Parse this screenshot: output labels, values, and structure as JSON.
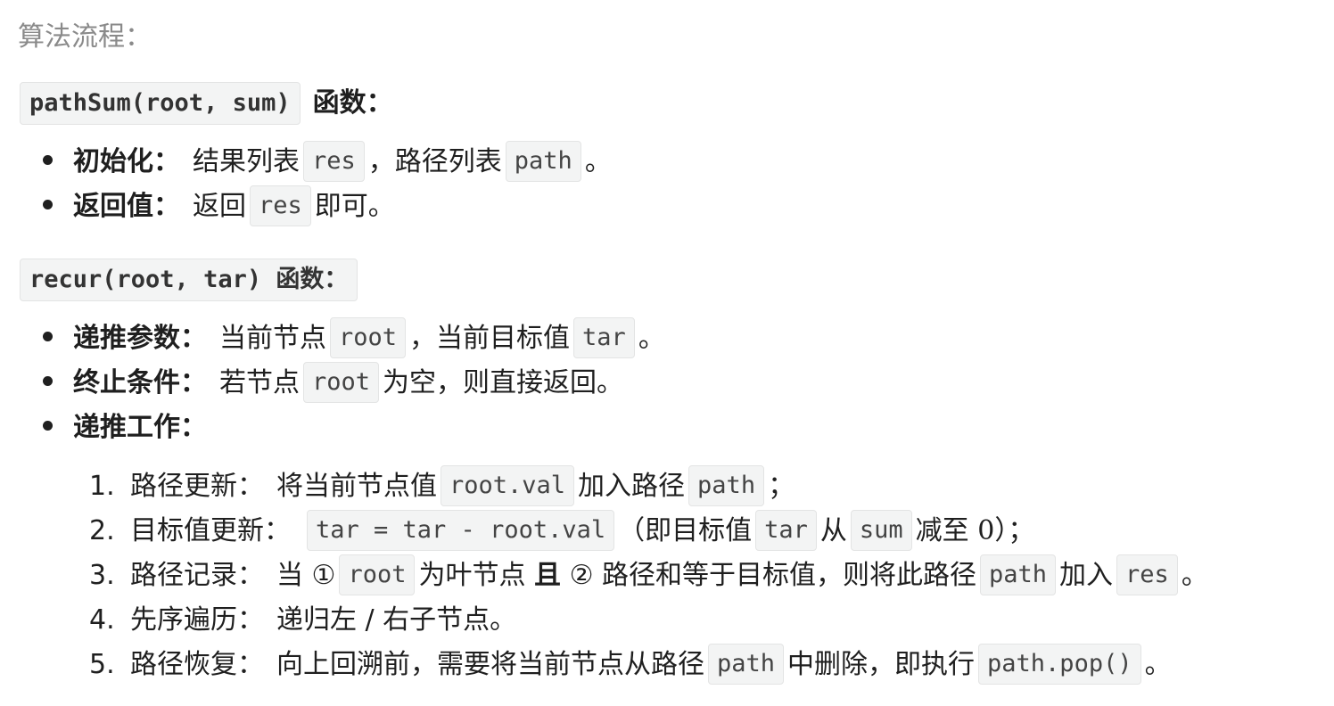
{
  "heading": "算法流程：",
  "path_sum": {
    "signature": "pathSum(root, sum)",
    "suffix": "函数：",
    "items": [
      {
        "label": "初始化：",
        "text1": "结果列表",
        "code1": "res",
        "text2": "，路径列表",
        "code2": "path",
        "text3": "。"
      },
      {
        "label": "返回值：",
        "text1": "返回",
        "code1": "res",
        "text2": "即可。"
      }
    ]
  },
  "recur": {
    "signature": "recur(root, tar)",
    "suffix": "函数：",
    "items": [
      {
        "label": "递推参数：",
        "text1": "当前节点",
        "code1": "root",
        "text2": "，当前目标值",
        "code2": "tar",
        "text3": "。"
      },
      {
        "label": "终止条件：",
        "text1": "若节点",
        "code1": "root",
        "text2": "为空，则直接返回。"
      },
      {
        "label": "递推工作："
      }
    ],
    "steps": [
      {
        "num": "1.",
        "label": "路径更新：",
        "text1": "将当前节点值",
        "code1": "root.val",
        "text2": "加入路径",
        "code2": "path",
        "text3": "；"
      },
      {
        "num": "2.",
        "label": "目标值更新：",
        "code1": "tar = tar - root.val",
        "text1": "（即目标值",
        "code2": "tar",
        "text2": "从",
        "code3": "sum",
        "text3": "减至",
        "math": "0",
        "text4": "）；"
      },
      {
        "num": "3.",
        "label": "路径记录：",
        "text1": "当 ①",
        "code1": "root",
        "text2": "为叶节点",
        "strong": "且",
        "text3": "② 路径和等于目标值，则将此路径",
        "code2": "path",
        "text4": "加入",
        "code3": "res",
        "text5": "。"
      },
      {
        "num": "4.",
        "label": "先序遍历：",
        "text1": "递归左 / 右子节点。"
      },
      {
        "num": "5.",
        "label": "路径恢复：",
        "text1": "向上回溯前，需要将当前节点从路径",
        "code1": "path",
        "text2": "中删除，即执行",
        "code2": "path.pop()",
        "text3": "。"
      }
    ]
  }
}
